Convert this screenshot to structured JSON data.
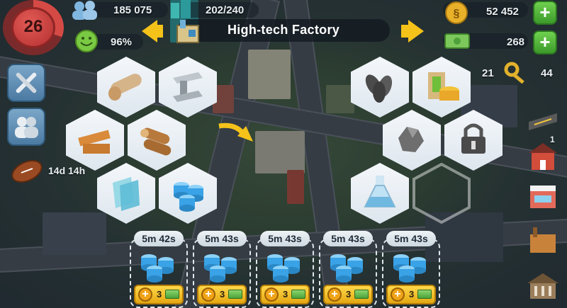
{
  "top": {
    "level": "26",
    "population": "185 075",
    "happiness": "96%",
    "capacity": "202/240",
    "simoleons": "52 452",
    "simcash": "268",
    "golden_keys": "21",
    "platinum_keys": "44"
  },
  "title": "High-tech Factory",
  "side": {
    "event_timer": "14d 14h",
    "store_badge": "1"
  },
  "left_items": [
    {
      "name": "textiles"
    },
    {
      "name": "metal"
    },
    {
      "name": "planks"
    },
    {
      "name": "wood"
    },
    {
      "name": "glass"
    },
    {
      "name": "plastic"
    }
  ],
  "right_items": [
    {
      "name": "seeds"
    },
    {
      "name": "paint"
    },
    {
      "name": "minerals"
    },
    {
      "name": "locked"
    },
    {
      "name": "chemicals"
    }
  ],
  "queue": [
    {
      "timer": "5m 42s",
      "cost": "3"
    },
    {
      "timer": "5m 43s",
      "cost": "3"
    },
    {
      "timer": "5m 43s",
      "cost": "3"
    },
    {
      "timer": "5m 43s",
      "cost": "3"
    },
    {
      "timer": "5m 43s",
      "cost": "3"
    }
  ],
  "colors": {
    "accent_yellow": "#f5c21a",
    "plus_green": "#4cb336",
    "level_red": "#d54a45",
    "plastic_blue": "#3aa2e6"
  }
}
